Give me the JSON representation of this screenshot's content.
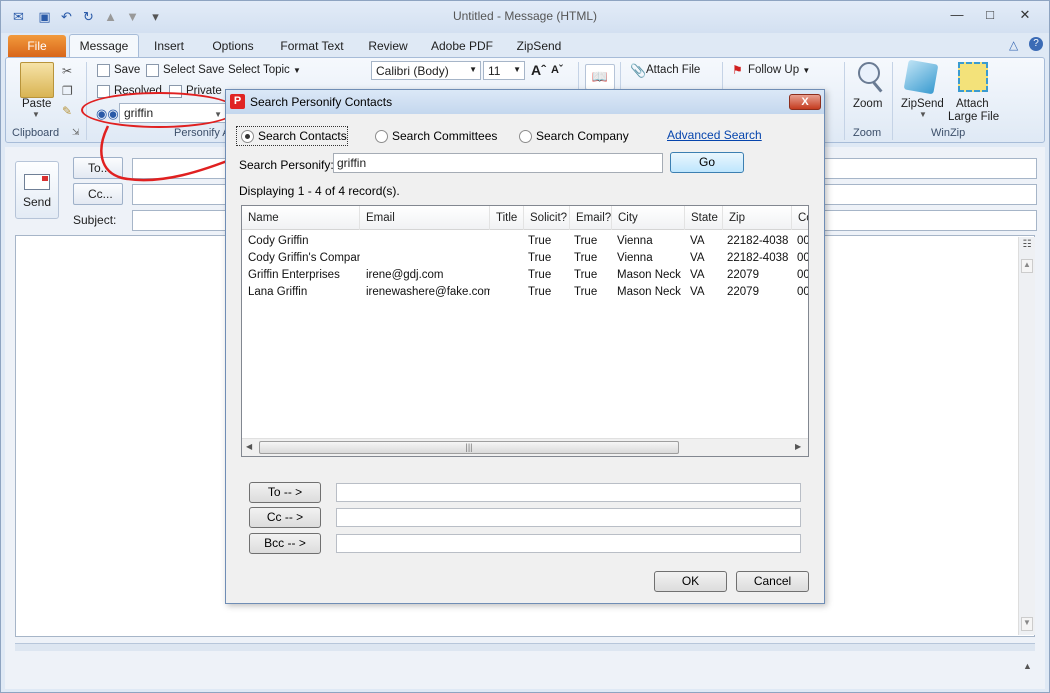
{
  "window": {
    "title": "Untitled  -  Message (HTML)"
  },
  "tabs": [
    "File",
    "Message",
    "Insert",
    "Options",
    "Format Text",
    "Review",
    "Adobe PDF",
    "ZipSend"
  ],
  "ribbon": {
    "paste_label": "Paste",
    "clipboard_label": "Clipboard",
    "save_label": "Save",
    "select_save_label": "Select Save",
    "select_topic_label": "Select Topic",
    "resolved_label": "Resolved",
    "private_label": "Private",
    "search_value": "griffin",
    "personify_group_label": "Personify A",
    "font_name": "Calibri (Body)",
    "font_size": "11",
    "attach_file_label": "Attach File",
    "follow_up_label": "Follow Up",
    "zoom_label": "Zoom",
    "zoom_group_label": "Zoom",
    "zipsend_label": "ZipSend",
    "attach_large_label": "Attach",
    "attach_large_label2": "Large File",
    "winzip_group_label": "WinZip"
  },
  "compose": {
    "send_label": "Send",
    "to_label": "To...",
    "cc_label": "Cc...",
    "subject_label": "Subject:"
  },
  "dialog": {
    "title": "Search Personify Contacts",
    "close_label": "X",
    "radio_contacts": "Search Contacts",
    "radio_committees": "Search Committees",
    "radio_company": "Search Company",
    "advanced_search": "Advanced Search",
    "search_label": "Search Personify:",
    "search_value": "griffin",
    "go_label": "Go",
    "status": "Displaying 1 - 4 of 4 record(s).",
    "columns": [
      "Name",
      "Email",
      "Title",
      "Solicit?",
      "Email?",
      "City",
      "State",
      "Zip",
      "Cc"
    ],
    "rows": [
      {
        "name": "Cody Griffin",
        "email": "",
        "title": "",
        "solicit": "True",
        "email_ok": "True",
        "city": "Vienna",
        "state": "VA",
        "zip": "22182-4038",
        "cc": "00"
      },
      {
        "name": "Cody Griffin's Company",
        "email": "",
        "title": "",
        "solicit": "True",
        "email_ok": "True",
        "city": "Vienna",
        "state": "VA",
        "zip": "22182-4038",
        "cc": "00"
      },
      {
        "name": "Griffin Enterprises",
        "email": "irene@gdj.com",
        "title": "",
        "solicit": "True",
        "email_ok": "True",
        "city": "Mason Neck",
        "state": "VA",
        "zip": "22079",
        "cc": "00"
      },
      {
        "name": "Lana Griffin",
        "email": "irenewashere@fake.com",
        "title": "",
        "solicit": "True",
        "email_ok": "True",
        "city": "Mason Neck",
        "state": "VA",
        "zip": "22079",
        "cc": "00"
      }
    ],
    "to_btn": "To -- >",
    "cc_btn": "Cc -- >",
    "bcc_btn": "Bcc -- >",
    "ok_label": "OK",
    "cancel_label": "Cancel"
  },
  "colors": {
    "annotation_red": "#e02020",
    "link_blue": "#0645ad",
    "file_tab_orange": "#e57a24"
  }
}
